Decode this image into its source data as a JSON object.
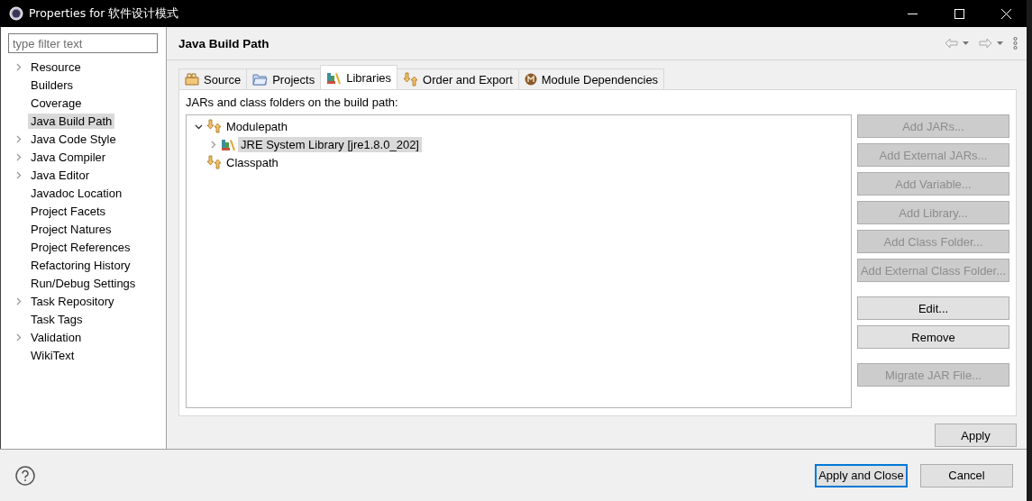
{
  "window": {
    "title": "Properties for 软件设计模式"
  },
  "filter": {
    "placeholder": "type filter text"
  },
  "sidebar": {
    "items": [
      {
        "label": "Resource",
        "expandable": true,
        "selected": false
      },
      {
        "label": "Builders",
        "expandable": false,
        "selected": false
      },
      {
        "label": "Coverage",
        "expandable": false,
        "selected": false
      },
      {
        "label": "Java Build Path",
        "expandable": false,
        "selected": true
      },
      {
        "label": "Java Code Style",
        "expandable": true,
        "selected": false
      },
      {
        "label": "Java Compiler",
        "expandable": true,
        "selected": false
      },
      {
        "label": "Java Editor",
        "expandable": true,
        "selected": false
      },
      {
        "label": "Javadoc Location",
        "expandable": false,
        "selected": false
      },
      {
        "label": "Project Facets",
        "expandable": false,
        "selected": false
      },
      {
        "label": "Project Natures",
        "expandable": false,
        "selected": false
      },
      {
        "label": "Project References",
        "expandable": false,
        "selected": false
      },
      {
        "label": "Refactoring History",
        "expandable": false,
        "selected": false
      },
      {
        "label": "Run/Debug Settings",
        "expandable": false,
        "selected": false
      },
      {
        "label": "Task Repository",
        "expandable": true,
        "selected": false
      },
      {
        "label": "Task Tags",
        "expandable": false,
        "selected": false
      },
      {
        "label": "Validation",
        "expandable": true,
        "selected": false
      },
      {
        "label": "WikiText",
        "expandable": false,
        "selected": false
      }
    ]
  },
  "page": {
    "title": "Java Build Path"
  },
  "tabs": [
    {
      "label": "Source",
      "selected": false
    },
    {
      "label": "Projects",
      "selected": false
    },
    {
      "label": "Libraries",
      "selected": true
    },
    {
      "label": "Order and Export",
      "selected": false
    },
    {
      "label": "Module Dependencies",
      "selected": false
    }
  ],
  "description": "JARs and class folders on the build path:",
  "tree": [
    {
      "label": "Modulepath",
      "expandable": true,
      "expanded": true,
      "selected": false,
      "children": [
        {
          "label": "JRE System Library [jre1.8.0_202]",
          "expandable": true,
          "expanded": false,
          "selected": true
        }
      ]
    },
    {
      "label": "Classpath",
      "expandable": false,
      "selected": false
    }
  ],
  "button_groups": [
    [
      {
        "label": "Add JARs...",
        "disabled": true
      },
      {
        "label": "Add External JARs...",
        "disabled": true
      },
      {
        "label": "Add Variable...",
        "disabled": true
      },
      {
        "label": "Add Library...",
        "disabled": true
      },
      {
        "label": "Add Class Folder...",
        "disabled": true
      },
      {
        "label": "Add External Class Folder...",
        "disabled": true
      }
    ],
    [
      {
        "label": "Edit...",
        "disabled": false
      },
      {
        "label": "Remove",
        "disabled": false
      }
    ],
    [
      {
        "label": "Migrate JAR File...",
        "disabled": true
      }
    ]
  ],
  "apply": {
    "label": "Apply"
  },
  "footer_buttons": [
    {
      "label": "Apply and Close",
      "default": true
    },
    {
      "label": "Cancel",
      "default": false
    }
  ]
}
